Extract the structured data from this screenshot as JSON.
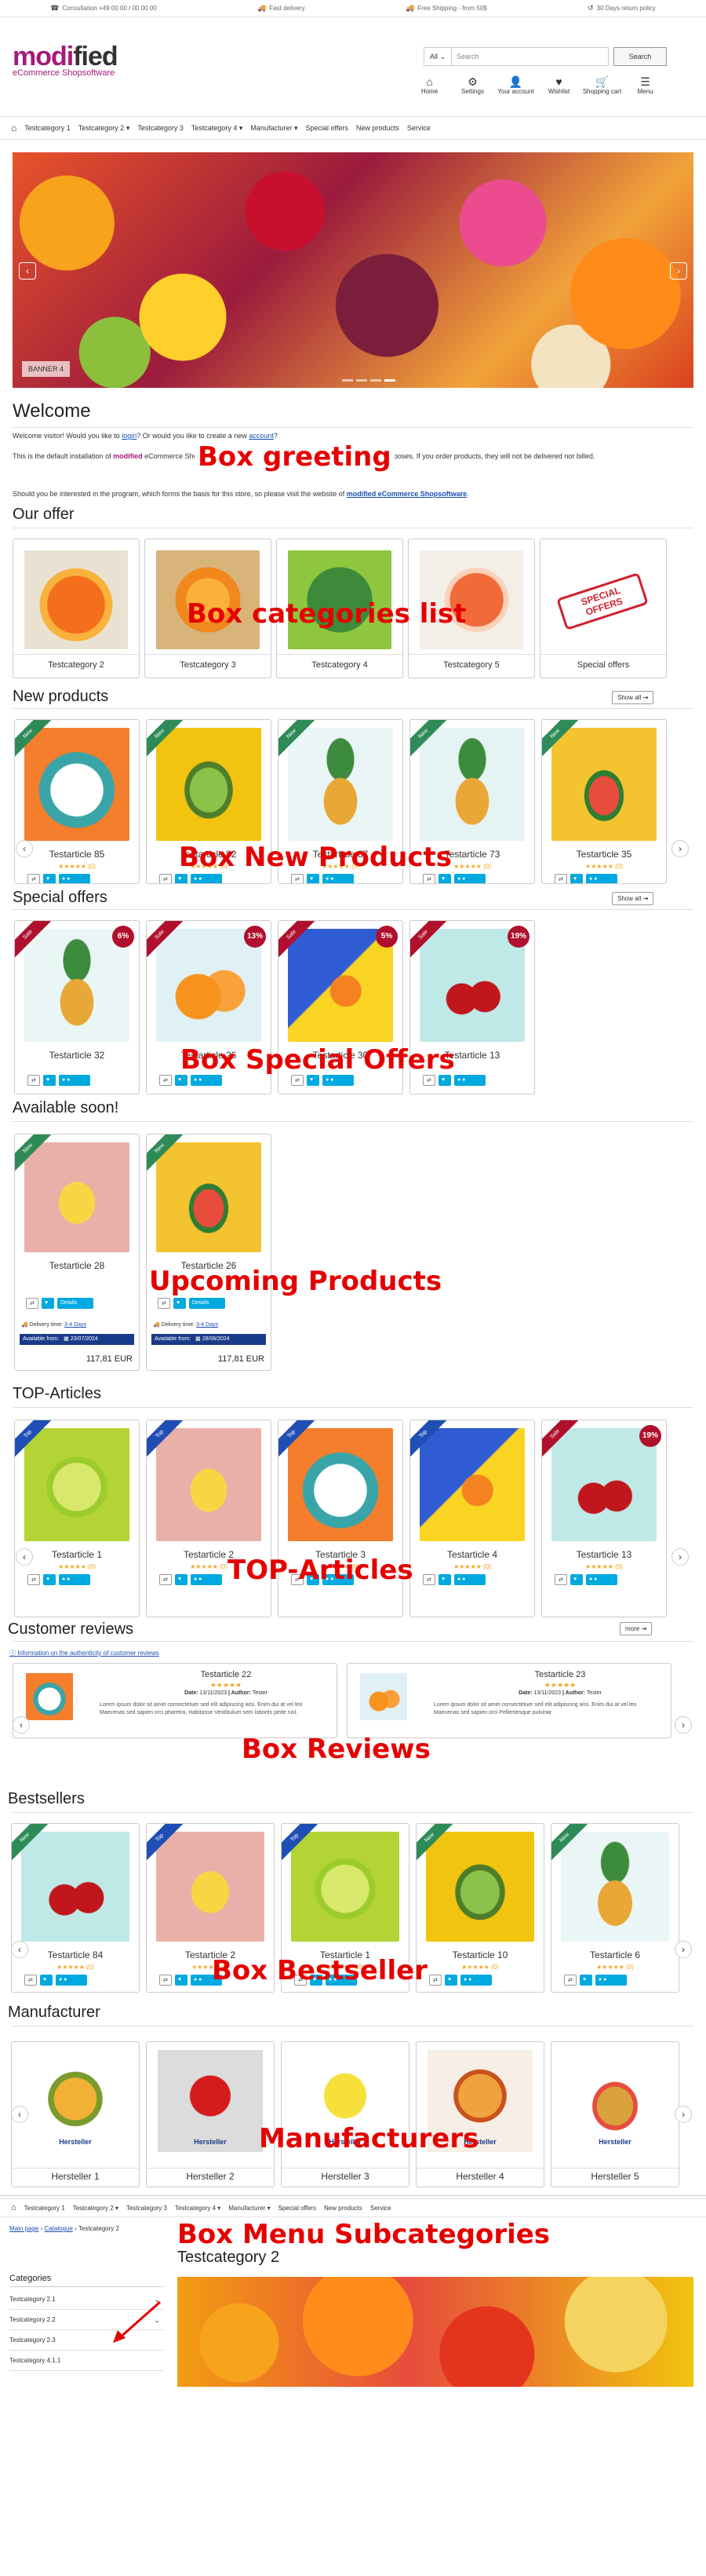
{
  "topbar": {
    "consultation": "Consultation +49 00 00 / 00 00 00",
    "delivery": "Fast delivery",
    "shipping": "Free Shipping - from 50$",
    "returns": "30 Days return policy"
  },
  "logo": {
    "brand_pre": "modi",
    "brand_fied": "fied",
    "tagline": "eCommerce Shopsoftware"
  },
  "search": {
    "category": "All",
    "placeholder": "Search",
    "button": "Search"
  },
  "iconnav": [
    {
      "icon": "home-icon",
      "glyph": "⌂",
      "label": "Home"
    },
    {
      "icon": "gear-icon",
      "glyph": "⚙",
      "label": "Settings"
    },
    {
      "icon": "user-icon",
      "glyph": "👤",
      "label": "Your account"
    },
    {
      "icon": "heart-icon",
      "glyph": "♥",
      "label": "Wishlist"
    },
    {
      "icon": "cart-icon",
      "glyph": "🛒",
      "label": "Shopping cart"
    },
    {
      "icon": "menu-icon",
      "glyph": "☰",
      "label": "Menu"
    }
  ],
  "catnav": [
    "Testcategory 1",
    "Testcategory 2 ▾",
    "Testcategory 3",
    "Testcategory 4 ▾",
    "Manufacturer ▾",
    "Special offers",
    "New products",
    "Service"
  ],
  "banner": {
    "label": "BANNER 4"
  },
  "welcome": {
    "title": "Welcome",
    "l1a": "Welcome visitor! Would you like to ",
    "login": "login",
    "l1b": "? Or would you like to create a new ",
    "account": "account",
    "l1c": "?",
    "l2a": "This is the default installation of ",
    "l2b": "modified",
    "l2c": " eCommerce Shopsoftware. All products shown here are for demonstrational purposes. If you order products, they will not be delivered nor billed.",
    "l3a": "Should you be interested in the program, which forms the basis for this store, so please visit the website of ",
    "l3link": "modified eCommerce Shopsoftware",
    "l3c": ".",
    "annotation": "Box greeting"
  },
  "our_offer": {
    "title": "Our offer",
    "annotation": "Box categories list",
    "items": [
      "Testcategory 2",
      "Testcategory 3",
      "Testcategory 4",
      "Testcategory 5",
      "Special offers"
    ],
    "special_stamp": "SPECIAL OFFERS"
  },
  "new_products": {
    "title": "New products",
    "show_all": "Show all",
    "annotation": "Box New Products",
    "items": [
      {
        "name": "Testarticle 85",
        "ribbon": "New",
        "reviews": "(0)"
      },
      {
        "name": "Testarticle 82",
        "ribbon": "New",
        "reviews": "(0)"
      },
      {
        "name": "Testarticle 87",
        "ribbon": "New",
        "reviews": "(0)"
      },
      {
        "name": "Testarticle 73",
        "ribbon": "New",
        "reviews": "(0)"
      },
      {
        "name": "Testarticle 35",
        "ribbon": "New",
        "reviews": "(0)"
      }
    ]
  },
  "special_offers": {
    "title": "Special offers",
    "show_all": "Show all",
    "annotation": "Box Special Offers",
    "items": [
      {
        "name": "Testarticle 32",
        "ribbon": "Sale",
        "pct": "6%"
      },
      {
        "name": "Testarticle 26",
        "ribbon": "Sale",
        "pct": "13%"
      },
      {
        "name": "Testarticle 30",
        "ribbon": "Sale",
        "pct": "5%"
      },
      {
        "name": "Testarticle 13",
        "ribbon": "Sale",
        "pct": "19%"
      }
    ]
  },
  "available_soon": {
    "title": "Available soon!",
    "annotation": "Upcoming Products",
    "details": "Details",
    "delivery_label": "Delivery time: ",
    "delivery_value": "3-4 Days",
    "available_from": "Available from:",
    "items": [
      {
        "name": "Testarticle 28",
        "ribbon": "New",
        "date": "23/07/2024",
        "price": "117,81 EUR"
      },
      {
        "name": "Testarticle 26",
        "ribbon": "New",
        "date": "28/06/2024",
        "price": "117,81 EUR"
      }
    ]
  },
  "top_articles": {
    "title": "TOP-Articles",
    "annotation": "TOP-Articles",
    "items": [
      {
        "name": "Testarticle 1",
        "ribbon": "Top"
      },
      {
        "name": "Testarticle 2",
        "ribbon": "Top"
      },
      {
        "name": "Testarticle 3",
        "ribbon": "Top"
      },
      {
        "name": "Testarticle 4",
        "ribbon": "Top"
      },
      {
        "name": "Testarticle 13",
        "ribbon": "Sale",
        "pct": "19%"
      }
    ]
  },
  "reviews": {
    "title": "Customer reviews",
    "more": "more",
    "info": "Information on the authenticity of customer reviews",
    "annotation": "Box Reviews",
    "items": [
      {
        "name": "Testarticle 22",
        "date": "13/11/2023",
        "author": "Tester",
        "text": "Lorem ipsum dolor sit amet consectetuer sed elit adipiscing wisi. Enim dui at vel leo Maecenas sed sapien orci pharetra. Habitasse Vestibulum sem lobortis pede nisl."
      },
      {
        "name": "Testarticle 23",
        "date": "13/11/2023",
        "author": "Tester",
        "text": "Lorem ipsum dolor sit amet consectetuer sed elit adipiscing wisi. Enim dui at vel leo Maecenas sed sapien orci Pellentesque pulvinar."
      }
    ]
  },
  "bestsellers": {
    "title": "Bestsellers",
    "annotation": "Box Bestseller",
    "items": [
      {
        "name": "Testarticle 84",
        "ribbon": "New"
      },
      {
        "name": "Testarticle 2",
        "ribbon": "Top"
      },
      {
        "name": "Testarticle 1",
        "ribbon": "Top"
      },
      {
        "name": "Testarticle 10",
        "ribbon": "New"
      },
      {
        "name": "Testarticle 6",
        "ribbon": "New"
      }
    ]
  },
  "manufacturer": {
    "title": "Manufacturer",
    "annotation": "Manufacturers",
    "logo_text": "Hersteller",
    "items": [
      "Hersteller 1",
      "Hersteller 2",
      "Hersteller 3",
      "Hersteller 4",
      "Hersteller 5"
    ]
  },
  "subcategories": {
    "annotation": "Box Menu Subcategories",
    "catnav": [
      "Testcategory 1",
      "Testcategory 2 ▾",
      "Testcategory 3",
      "Testcategory 4 ▾",
      "Manufacturer ▾",
      "Special offers",
      "New products",
      "Service"
    ],
    "breadcrumb": [
      "Main page",
      "Catalogue",
      "Testcategory 2"
    ],
    "title": "Testcategory 2",
    "side_title": "Categories",
    "side_items": [
      "Testcategory 2.1",
      "Testcategory 2.2",
      "Testcategory 2.3",
      "Testcategory 4.1.1"
    ]
  },
  "colors": {
    "brand": "#a5197a",
    "new": "#2e8b57",
    "top": "#1f4fb5",
    "sale": "#b0102d",
    "annotation": "#e50000"
  }
}
